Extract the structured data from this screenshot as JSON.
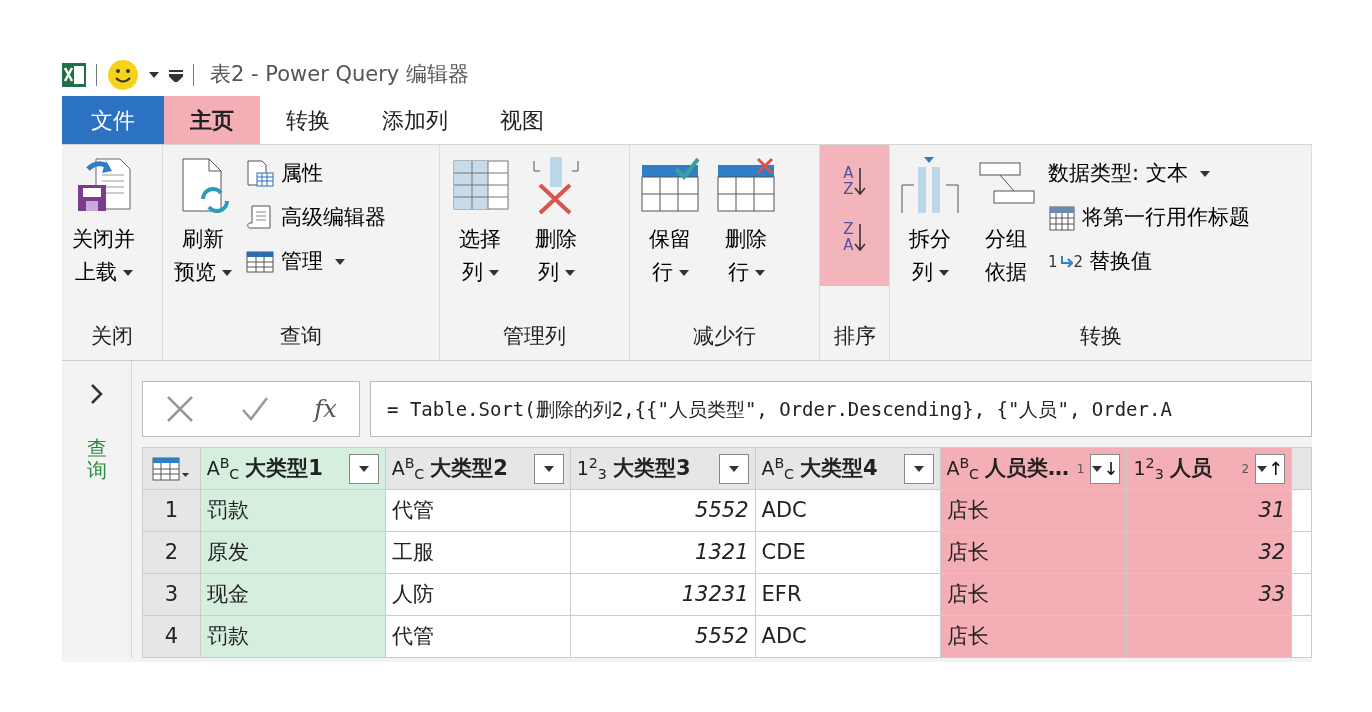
{
  "title_bar": {
    "title": "表2 - Power Query 编辑器"
  },
  "tabs": [
    {
      "label": "文件",
      "kind": "file",
      "selected": false,
      "highlighted": false
    },
    {
      "label": "主页",
      "kind": "tab",
      "selected": true,
      "highlighted": true
    },
    {
      "label": "转换",
      "kind": "tab",
      "selected": false,
      "highlighted": false
    },
    {
      "label": "添加列",
      "kind": "tab",
      "selected": false,
      "highlighted": false
    },
    {
      "label": "视图",
      "kind": "tab",
      "selected": false,
      "highlighted": false
    }
  ],
  "ribbon_groups": [
    {
      "label": "关闭",
      "highlighted": false,
      "items": [
        {
          "kind": "large",
          "label": [
            "关闭并",
            "上载"
          ],
          "dropdown": true
        }
      ]
    },
    {
      "label": "查询",
      "highlighted": false,
      "items": [
        {
          "kind": "large",
          "label": [
            "刷新",
            "预览"
          ],
          "dropdown": true
        },
        {
          "kind": "small",
          "label": "属性",
          "dropdown": false
        },
        {
          "kind": "small",
          "label": "高级编辑器",
          "dropdown": false
        },
        {
          "kind": "small",
          "label": "管理",
          "dropdown": true
        }
      ]
    },
    {
      "label": "管理列",
      "highlighted": false,
      "items": [
        {
          "kind": "large",
          "label": [
            "选择",
            "列"
          ],
          "dropdown": true
        },
        {
          "kind": "large",
          "label": [
            "删除",
            "列"
          ],
          "dropdown": true
        }
      ]
    },
    {
      "label": "减少行",
      "highlighted": false,
      "items": [
        {
          "kind": "large",
          "label": [
            "保留",
            "行"
          ],
          "dropdown": true
        },
        {
          "kind": "large",
          "label": [
            "删除",
            "行"
          ],
          "dropdown": true
        }
      ]
    },
    {
      "label": "排序",
      "highlighted": true,
      "items": [
        {
          "kind": "sort",
          "letters": [
            "A",
            "Z"
          ]
        },
        {
          "kind": "sort",
          "letters": [
            "Z",
            "A"
          ]
        }
      ]
    },
    {
      "label": "转换",
      "highlighted": false,
      "items": [
        {
          "kind": "large",
          "label": [
            "拆分",
            "列"
          ],
          "dropdown": true
        },
        {
          "kind": "large",
          "label": [
            "分组",
            "依据"
          ],
          "dropdown": false
        },
        {
          "kind": "small",
          "label": "数据类型: 文本",
          "dropdown": true
        },
        {
          "kind": "small",
          "label": "将第一行用作标题",
          "dropdown": false
        },
        {
          "kind": "small",
          "label": "替换值",
          "dropdown": false,
          "icon_digits": [
            "1",
            "2"
          ]
        }
      ]
    }
  ],
  "queries_pane": {
    "label": "查询"
  },
  "formula_bar": {
    "fx_label": "fx",
    "formula": "= Table.Sort(删除的列2,{{\"人员类型\", Order.Descending}, {\"人员\", Order.A"
  },
  "table": {
    "columns": [
      {
        "name": "大类型1",
        "type_label": "A$^{B}$$_{C}$",
        "kind": "text",
        "selected": true,
        "highlighted": false
      },
      {
        "name": "大类型2",
        "type_label": "A$^{B}$$_{C}$",
        "kind": "text",
        "selected": false,
        "highlighted": false
      },
      {
        "name": "大类型3",
        "type_label": "1$^{2}$$_{3}$",
        "kind": "number",
        "selected": false,
        "highlighted": false
      },
      {
        "name": "大类型4",
        "type_label": "A$^{B}$$_{C}$",
        "kind": "text",
        "selected": false,
        "highlighted": false
      },
      {
        "name": "人员类…",
        "type_label": "A$^{B}$$_{C}$",
        "kind": "text",
        "selected": false,
        "highlighted": true,
        "sort_arrow": "↓",
        "sort_index": "1"
      },
      {
        "name": "人员",
        "type_label": "1$^{2}$$_{3}$",
        "kind": "number",
        "selected": false,
        "highlighted": true,
        "sort_arrow": "↑",
        "sort_index": "2"
      }
    ],
    "rows": [
      {
        "number": "1",
        "cells": [
          "罚款",
          "代管",
          "5552",
          "ADC",
          "店长",
          "31"
        ]
      },
      {
        "number": "2",
        "cells": [
          "原发",
          "工服",
          "1321",
          "CDE",
          "店长",
          "32"
        ]
      },
      {
        "number": "3",
        "cells": [
          "现金",
          "人防",
          "13231",
          "EFR",
          "店长",
          "33"
        ]
      },
      {
        "number": "4",
        "cells": [
          "罚款",
          "代管",
          "5552",
          "ADC",
          "店长",
          null
        ]
      }
    ]
  }
}
